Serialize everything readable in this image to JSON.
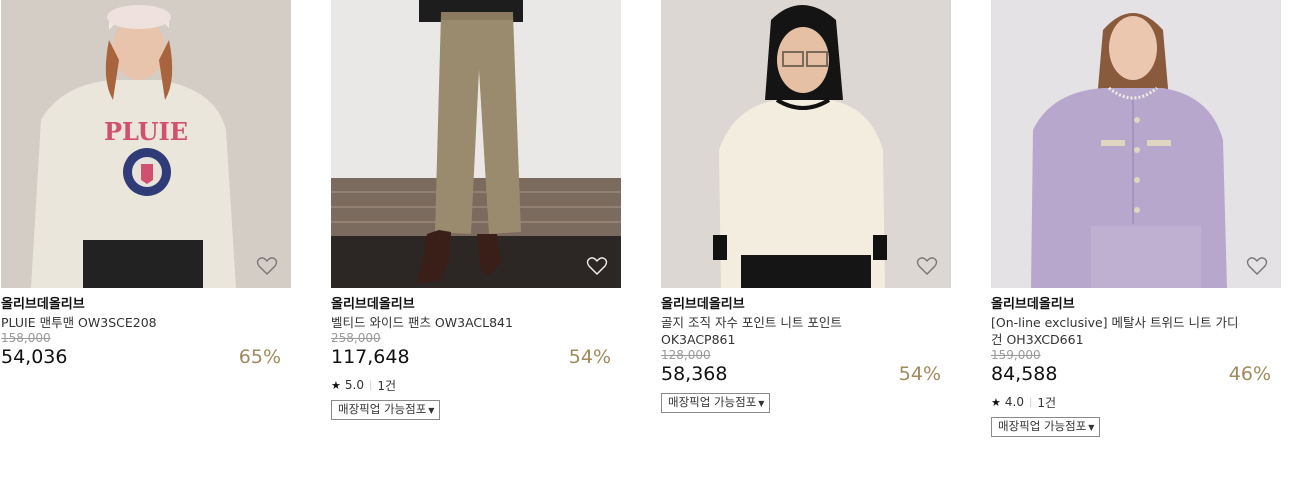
{
  "colors": {
    "discount": "#a08a5e",
    "original_price": "#9a9a9a",
    "text": "#111111"
  },
  "products": [
    {
      "brand": "올리브데올리브",
      "name": "PLUIE 맨투맨 OW3SCE208",
      "original_price": "158,000",
      "price": "54,036",
      "discount": "65%",
      "wishlist_icon": "heart-outline-icon"
    },
    {
      "brand": "올리브데올리브",
      "name": "벨티드 와이드 팬츠 OW3ACL841",
      "original_price": "258,000",
      "price": "117,648",
      "discount": "54%",
      "rating": "5.0",
      "review_count": "1건",
      "pickup_label": "매장픽업 가능점포",
      "wishlist_icon": "heart-outline-icon"
    },
    {
      "brand": "올리브데올리브",
      "name": "골지 조직 자수 포인트 니트 포인트 OK3ACP861",
      "original_price": "128,000",
      "price": "58,368",
      "discount": "54%",
      "pickup_label": "매장픽업 가능점포",
      "wishlist_icon": "heart-outline-icon"
    },
    {
      "brand": "올리브데올리브",
      "name": "[On-line exclusive] 메탈사 트위드 니트 가디건 OH3XCD661",
      "original_price": "159,000",
      "price": "84,588",
      "discount": "46%",
      "rating": "4.0",
      "review_count": "1건",
      "pickup_label": "매장픽업 가능점포",
      "wishlist_icon": "heart-outline-icon"
    }
  ]
}
